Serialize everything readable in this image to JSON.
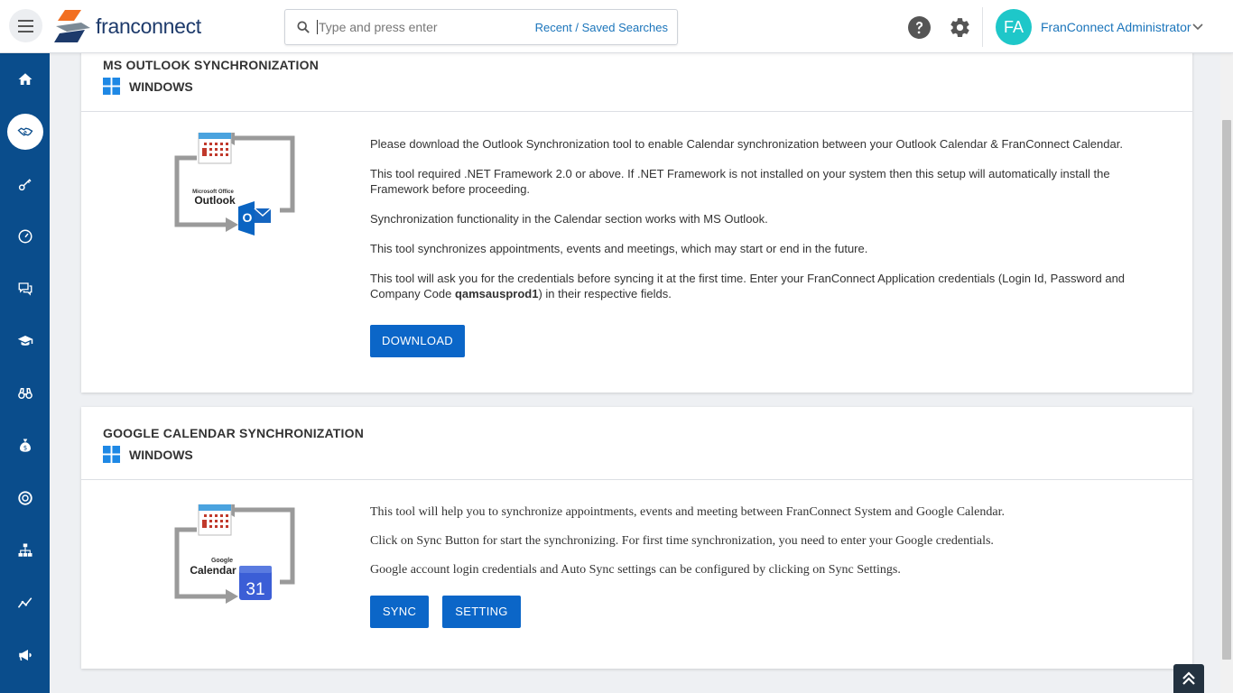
{
  "header": {
    "logo_text": "franconnect",
    "search_placeholder": "Type and press enter",
    "recent_saved": "Recent / Saved Searches",
    "user_initials": "FA",
    "user_name": "FranConnect Administrator"
  },
  "sidebar": {
    "items": [
      {
        "name": "home-icon"
      },
      {
        "name": "handshake-icon"
      },
      {
        "name": "key-icon"
      },
      {
        "name": "speedometer-icon"
      },
      {
        "name": "chat-icon"
      },
      {
        "name": "graduation-cap-icon"
      },
      {
        "name": "binoculars-icon"
      },
      {
        "name": "money-bag-icon"
      },
      {
        "name": "lifebuoy-icon"
      },
      {
        "name": "org-chart-icon"
      },
      {
        "name": "trend-icon"
      },
      {
        "name": "megaphone-icon"
      }
    ]
  },
  "outlook": {
    "title": "MS OUTLOOK SYNCHRONIZATION",
    "platform": "WINDOWS",
    "illustration_brand_small": "Microsoft Office",
    "illustration_brand": "Outlook",
    "illustration_letter": "O",
    "para1": "Please download the Outlook Synchronization tool to enable Calendar synchronization between your Outlook Calendar & FranConnect Calendar.",
    "para2a": "This tool required .NET Framework 2.0 or above. If .NET Framework is not installed on your system then this setup will automatically install the",
    "para2b": "Framework before proceeding.",
    "para3": "Synchronization functionality in the Calendar section works with MS Outlook.",
    "para4": "This tool synchronizes appointments, events and meetings, which may start or end in the future.",
    "para5a": "This tool will ask you for the credentials before syncing it at the first time. Enter your FranConnect Application credentials (Login Id, Password and",
    "para5b_prefix": "Company Code ",
    "company_code": "qamsausprod1",
    "para5b_suffix": ") in their respective fields.",
    "download_label": "DOWNLOAD"
  },
  "google": {
    "title": "GOOGLE CALENDAR SYNCHRONIZATION",
    "platform": "WINDOWS",
    "illustration_brand_small": "Google",
    "illustration_brand": "Calendar",
    "illustration_day": "31",
    "para1": "This tool will help you to synchronize appointments, events and meeting between FranConnect System and Google Calendar.",
    "para2": "Click on Sync Button for start the synchronizing. For first time synchronization, you need to enter your Google credentials.",
    "para3": "Google account login credentials and Auto Sync settings can be configured by clicking on Sync Settings.",
    "sync_label": "SYNC",
    "setting_label": "SETTING"
  },
  "colors": {
    "primary": "#0b66c8",
    "sidebar": "#0a4d8c",
    "link": "#1b75bb",
    "avatar": "#1ec7c9"
  }
}
